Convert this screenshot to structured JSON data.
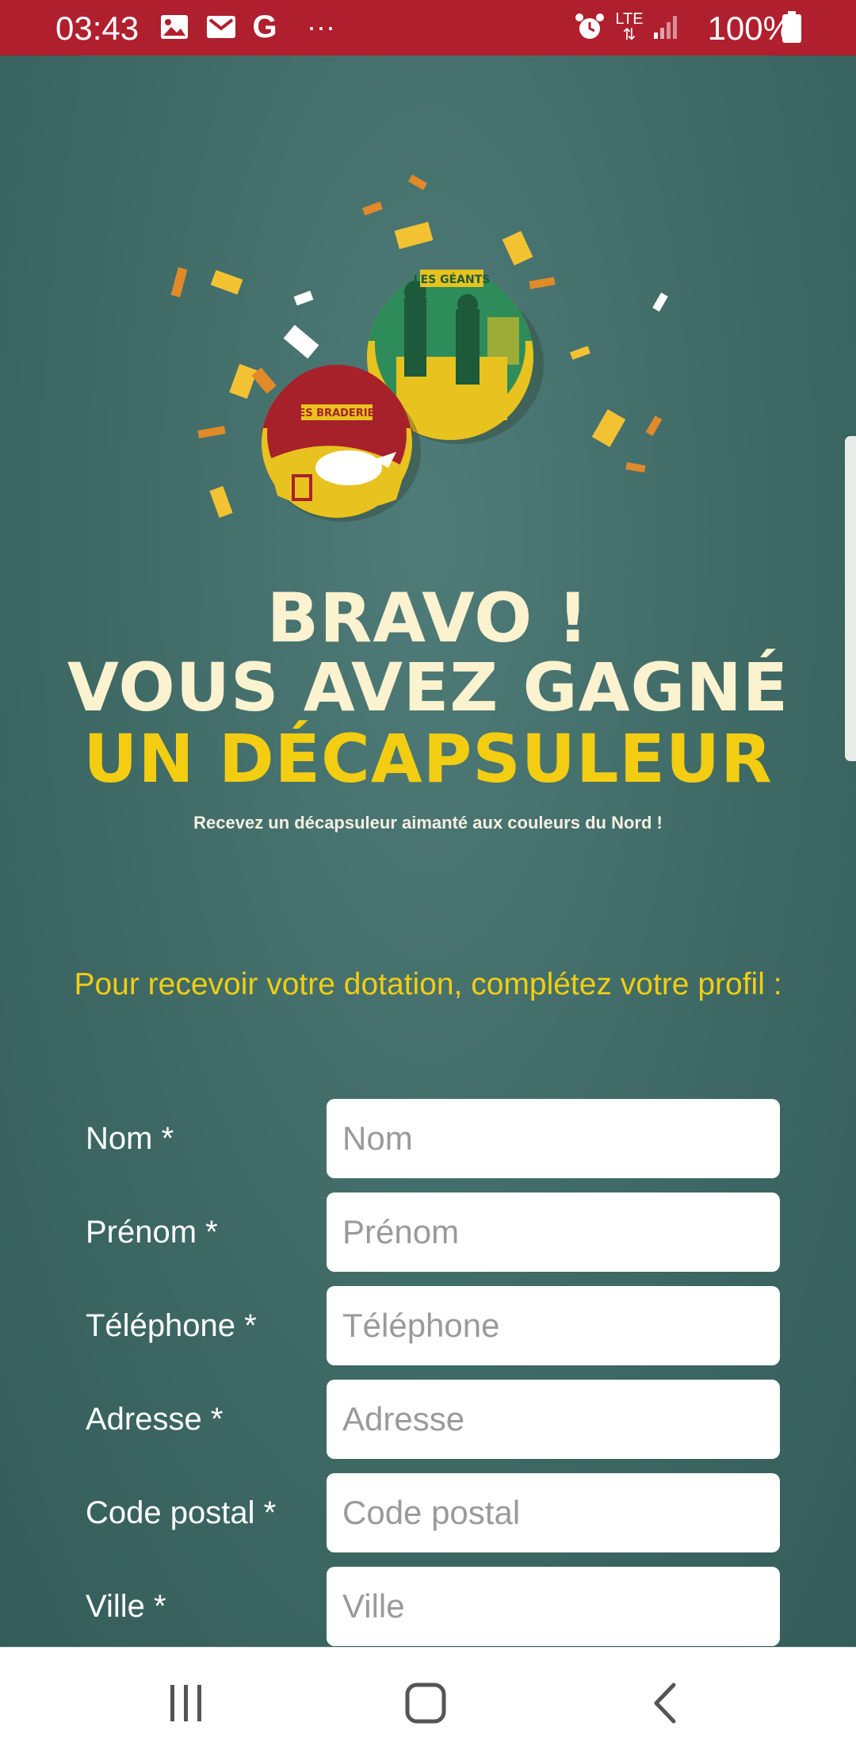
{
  "status_bar": {
    "time": "03:43",
    "icons_left": [
      "image-icon",
      "gmail-icon",
      "google-icon",
      "more-dots-icon"
    ],
    "icons_right": [
      "alarm-icon",
      "lte-icon",
      "signal-icon"
    ],
    "lte_label": "LTE",
    "battery": "100%",
    "more": "···"
  },
  "hero": {
    "badge_left_text": "LES BRADERIES",
    "badge_right_text": "LES GÉANTS",
    "title_line1": "BRAVO !",
    "title_line2": "VOUS AVEZ GAGNÉ",
    "title_line3": "UN DÉCAPSULEUR",
    "subtitle": "Recevez un décapsuleur aimanté aux couleurs du Nord !",
    "colors": {
      "cream": "#fbf2cf",
      "yellow": "#f3cd12",
      "background": "#3f6b68"
    }
  },
  "form": {
    "prompt": "Pour recevoir votre dotation, complétez votre profil :",
    "fields": [
      {
        "label": "Nom *",
        "placeholder": "Nom",
        "value": ""
      },
      {
        "label": "Prénom *",
        "placeholder": "Prénom",
        "value": ""
      },
      {
        "label": "Téléphone *",
        "placeholder": "Téléphone",
        "value": ""
      },
      {
        "label": "Adresse *",
        "placeholder": "Adresse",
        "value": ""
      },
      {
        "label": "Code postal *",
        "placeholder": "Code postal",
        "value": ""
      },
      {
        "label": "Ville *",
        "placeholder": "Ville",
        "value": ""
      }
    ]
  },
  "nav_bar": {
    "buttons": [
      "recent-apps-icon",
      "home-icon",
      "back-icon"
    ]
  }
}
